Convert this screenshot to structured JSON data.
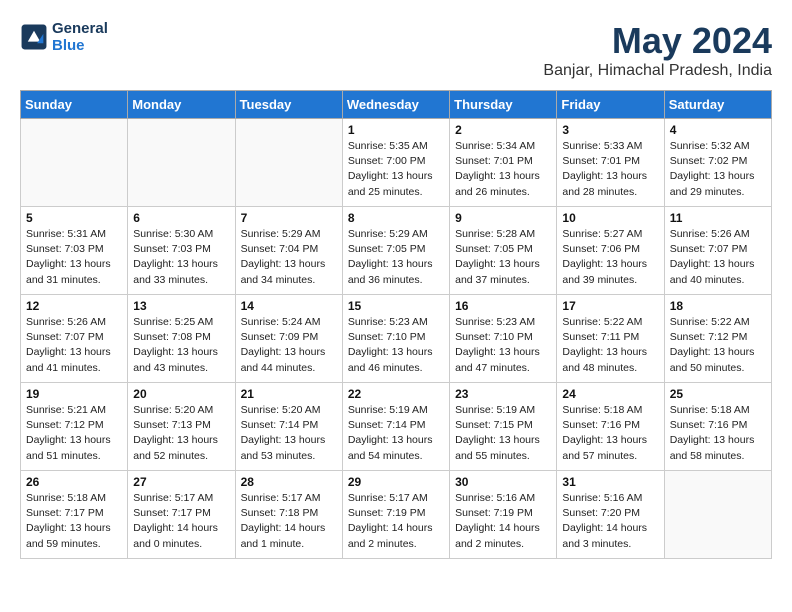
{
  "header": {
    "logo_line1": "General",
    "logo_line2": "Blue",
    "month": "May 2024",
    "location": "Banjar, Himachal Pradesh, India"
  },
  "weekdays": [
    "Sunday",
    "Monday",
    "Tuesday",
    "Wednesday",
    "Thursday",
    "Friday",
    "Saturday"
  ],
  "rows": [
    [
      {
        "day": "",
        "info": ""
      },
      {
        "day": "",
        "info": ""
      },
      {
        "day": "",
        "info": ""
      },
      {
        "day": "1",
        "info": "Sunrise: 5:35 AM\nSunset: 7:00 PM\nDaylight: 13 hours\nand 25 minutes."
      },
      {
        "day": "2",
        "info": "Sunrise: 5:34 AM\nSunset: 7:01 PM\nDaylight: 13 hours\nand 26 minutes."
      },
      {
        "day": "3",
        "info": "Sunrise: 5:33 AM\nSunset: 7:01 PM\nDaylight: 13 hours\nand 28 minutes."
      },
      {
        "day": "4",
        "info": "Sunrise: 5:32 AM\nSunset: 7:02 PM\nDaylight: 13 hours\nand 29 minutes."
      }
    ],
    [
      {
        "day": "5",
        "info": "Sunrise: 5:31 AM\nSunset: 7:03 PM\nDaylight: 13 hours\nand 31 minutes."
      },
      {
        "day": "6",
        "info": "Sunrise: 5:30 AM\nSunset: 7:03 PM\nDaylight: 13 hours\nand 33 minutes."
      },
      {
        "day": "7",
        "info": "Sunrise: 5:29 AM\nSunset: 7:04 PM\nDaylight: 13 hours\nand 34 minutes."
      },
      {
        "day": "8",
        "info": "Sunrise: 5:29 AM\nSunset: 7:05 PM\nDaylight: 13 hours\nand 36 minutes."
      },
      {
        "day": "9",
        "info": "Sunrise: 5:28 AM\nSunset: 7:05 PM\nDaylight: 13 hours\nand 37 minutes."
      },
      {
        "day": "10",
        "info": "Sunrise: 5:27 AM\nSunset: 7:06 PM\nDaylight: 13 hours\nand 39 minutes."
      },
      {
        "day": "11",
        "info": "Sunrise: 5:26 AM\nSunset: 7:07 PM\nDaylight: 13 hours\nand 40 minutes."
      }
    ],
    [
      {
        "day": "12",
        "info": "Sunrise: 5:26 AM\nSunset: 7:07 PM\nDaylight: 13 hours\nand 41 minutes."
      },
      {
        "day": "13",
        "info": "Sunrise: 5:25 AM\nSunset: 7:08 PM\nDaylight: 13 hours\nand 43 minutes."
      },
      {
        "day": "14",
        "info": "Sunrise: 5:24 AM\nSunset: 7:09 PM\nDaylight: 13 hours\nand 44 minutes."
      },
      {
        "day": "15",
        "info": "Sunrise: 5:23 AM\nSunset: 7:10 PM\nDaylight: 13 hours\nand 46 minutes."
      },
      {
        "day": "16",
        "info": "Sunrise: 5:23 AM\nSunset: 7:10 PM\nDaylight: 13 hours\nand 47 minutes."
      },
      {
        "day": "17",
        "info": "Sunrise: 5:22 AM\nSunset: 7:11 PM\nDaylight: 13 hours\nand 48 minutes."
      },
      {
        "day": "18",
        "info": "Sunrise: 5:22 AM\nSunset: 7:12 PM\nDaylight: 13 hours\nand 50 minutes."
      }
    ],
    [
      {
        "day": "19",
        "info": "Sunrise: 5:21 AM\nSunset: 7:12 PM\nDaylight: 13 hours\nand 51 minutes."
      },
      {
        "day": "20",
        "info": "Sunrise: 5:20 AM\nSunset: 7:13 PM\nDaylight: 13 hours\nand 52 minutes."
      },
      {
        "day": "21",
        "info": "Sunrise: 5:20 AM\nSunset: 7:14 PM\nDaylight: 13 hours\nand 53 minutes."
      },
      {
        "day": "22",
        "info": "Sunrise: 5:19 AM\nSunset: 7:14 PM\nDaylight: 13 hours\nand 54 minutes."
      },
      {
        "day": "23",
        "info": "Sunrise: 5:19 AM\nSunset: 7:15 PM\nDaylight: 13 hours\nand 55 minutes."
      },
      {
        "day": "24",
        "info": "Sunrise: 5:18 AM\nSunset: 7:16 PM\nDaylight: 13 hours\nand 57 minutes."
      },
      {
        "day": "25",
        "info": "Sunrise: 5:18 AM\nSunset: 7:16 PM\nDaylight: 13 hours\nand 58 minutes."
      }
    ],
    [
      {
        "day": "26",
        "info": "Sunrise: 5:18 AM\nSunset: 7:17 PM\nDaylight: 13 hours\nand 59 minutes."
      },
      {
        "day": "27",
        "info": "Sunrise: 5:17 AM\nSunset: 7:17 PM\nDaylight: 14 hours\nand 0 minutes."
      },
      {
        "day": "28",
        "info": "Sunrise: 5:17 AM\nSunset: 7:18 PM\nDaylight: 14 hours\nand 1 minute."
      },
      {
        "day": "29",
        "info": "Sunrise: 5:17 AM\nSunset: 7:19 PM\nDaylight: 14 hours\nand 2 minutes."
      },
      {
        "day": "30",
        "info": "Sunrise: 5:16 AM\nSunset: 7:19 PM\nDaylight: 14 hours\nand 2 minutes."
      },
      {
        "day": "31",
        "info": "Sunrise: 5:16 AM\nSunset: 7:20 PM\nDaylight: 14 hours\nand 3 minutes."
      },
      {
        "day": "",
        "info": ""
      }
    ]
  ]
}
